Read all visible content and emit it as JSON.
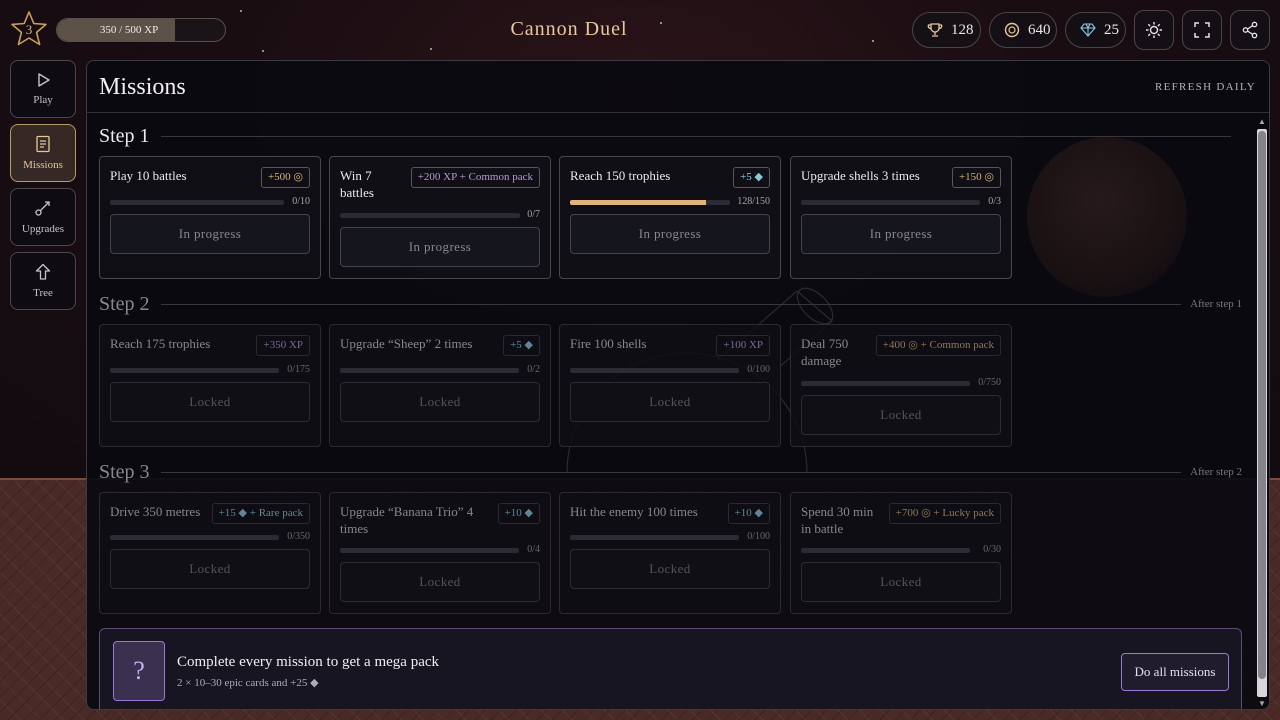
{
  "game": {
    "title": "Cannon Duel"
  },
  "player": {
    "level": "3",
    "xp_text": "350 / 500 XP",
    "xp_progress": 0.7
  },
  "currencies": {
    "trophies": "128",
    "coins": "640",
    "gems": "25"
  },
  "sidebar": {
    "items": [
      {
        "label": "Play",
        "icon": "play-icon",
        "active": false
      },
      {
        "label": "Missions",
        "icon": "clipboard-icon",
        "active": true
      },
      {
        "label": "Upgrades",
        "icon": "upgrade-icon",
        "active": false
      },
      {
        "label": "Tree",
        "icon": "arrow-up-icon",
        "active": false
      }
    ]
  },
  "missions": {
    "title": "Missions",
    "refresh_label": "REFRESH DAILY",
    "steps": [
      {
        "label": "Step 1",
        "after": "",
        "cards": [
          {
            "title": "Play 10 battles",
            "reward": "+500 ◎",
            "progress_text": "0/10",
            "progress": 0,
            "button": "In progress"
          },
          {
            "title": "Win 7 battles",
            "reward": "+200 XP + Common pack",
            "progress_text": "0/7",
            "progress": 0,
            "button": "In progress"
          },
          {
            "title": "Reach 150 trophies",
            "reward": "+5 ◆",
            "progress_text": "128/150",
            "progress": 0.853,
            "button": "In progress"
          },
          {
            "title": "Upgrade shells 3 times",
            "reward": "+150 ◎",
            "progress_text": "0/3",
            "progress": 0,
            "button": "In progress"
          }
        ]
      },
      {
        "label": "Step 2",
        "after": "After step 1",
        "cards": [
          {
            "title": "Reach 175 trophies",
            "reward": "+350 XP",
            "progress_text": "0/175",
            "progress": 0,
            "button": "Locked"
          },
          {
            "title": "Upgrade “Sheep” 2 times",
            "reward": "+5 ◆",
            "progress_text": "0/2",
            "progress": 0,
            "button": "Locked"
          },
          {
            "title": "Fire 100 shells",
            "reward": "+100 XP",
            "progress_text": "0/100",
            "progress": 0,
            "button": "Locked"
          },
          {
            "title": "Deal 750 damage",
            "reward": "+400 ◎ + Common pack",
            "progress_text": "0/750",
            "progress": 0,
            "button": "Locked"
          }
        ]
      },
      {
        "label": "Step 3",
        "after": "After step 2",
        "cards": [
          {
            "title": "Drive 350 metres",
            "reward": "+15 ◆ + Rare pack",
            "progress_text": "0/350",
            "progress": 0,
            "button": "Locked"
          },
          {
            "title": "Upgrade “Banana Trio” 4 times",
            "reward": "+10 ◆",
            "progress_text": "0/4",
            "progress": 0,
            "button": "Locked"
          },
          {
            "title": "Hit the enemy 100 times",
            "reward": "+10 ◆",
            "progress_text": "0/100",
            "progress": 0,
            "button": "Locked"
          },
          {
            "title": "Spend 30 min in battle",
            "reward": "+700 ◎ + Lucky pack",
            "progress_text": "0/30",
            "progress": 0,
            "button": "Locked"
          }
        ]
      }
    ],
    "mega": {
      "icon_glyph": "?",
      "title": "Complete every mission to get a mega pack",
      "subtitle": "2 × 10–30 epic cards and +25 ◆",
      "button": "Do all missions"
    }
  },
  "colors": {
    "accent": "#e0b47a",
    "purple": "#9a7ad0",
    "gem": "#8ac8e0"
  }
}
